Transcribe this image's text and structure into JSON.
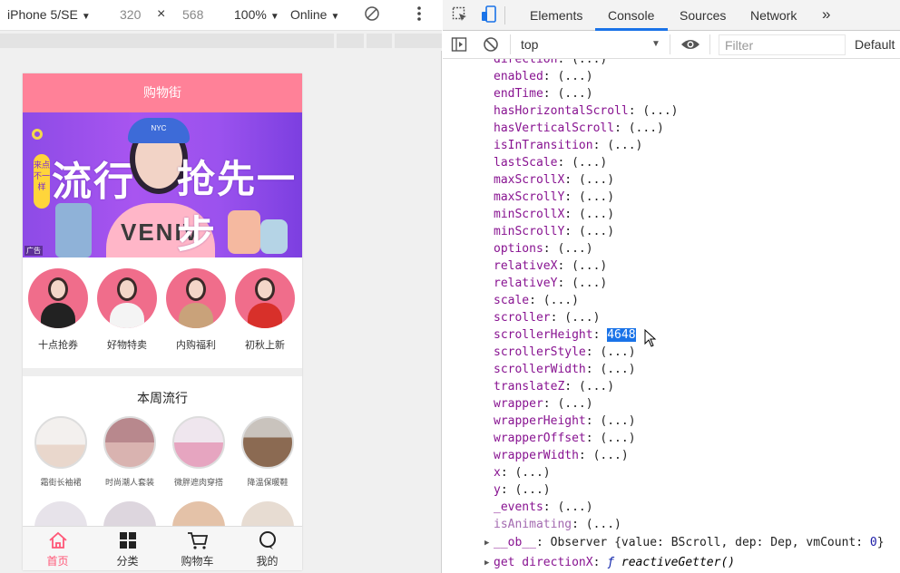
{
  "device_toolbar": {
    "device": "iPhone 5/SE",
    "width": "320",
    "times": "×",
    "height": "568",
    "zoom": "100%",
    "network": "Online"
  },
  "app": {
    "title": "购物街",
    "banner": {
      "headline_left": "流行",
      "headline_right": "抢先一步",
      "tag": "来点不一样",
      "cap_text": "NYC",
      "shirt_text": "VENIV",
      "ad_label": "广告"
    },
    "categories": [
      {
        "label": "十点抢券"
      },
      {
        "label": "好物特卖"
      },
      {
        "label": "内购福利"
      },
      {
        "label": "初秋上新"
      }
    ],
    "weekly": {
      "title": "本周流行",
      "items": [
        {
          "label": "霜街长袖裙"
        },
        {
          "label": "时尚潮人套装"
        },
        {
          "label": "微胖遮肉穿搭"
        },
        {
          "label": "降温保暖鞋"
        }
      ]
    },
    "tabs": [
      {
        "label": "首页",
        "icon": "home-icon"
      },
      {
        "label": "分类",
        "icon": "grid-icon"
      },
      {
        "label": "购物车",
        "icon": "cart-icon"
      },
      {
        "label": "我的",
        "icon": "user-icon"
      }
    ]
  },
  "devtools": {
    "tabs": [
      "Elements",
      "Console",
      "Sources",
      "Network"
    ],
    "active_tab": "Console",
    "more": "»",
    "context": "top",
    "filter_placeholder": "Filter",
    "levels": "Default",
    "properties": [
      {
        "key": "direction",
        "val": "(...)"
      },
      {
        "key": "enabled",
        "val": "(...)"
      },
      {
        "key": "endTime",
        "val": "(...)"
      },
      {
        "key": "hasHorizontalScroll",
        "val": "(...)"
      },
      {
        "key": "hasVerticalScroll",
        "val": "(...)"
      },
      {
        "key": "isInTransition",
        "val": "(...)"
      },
      {
        "key": "lastScale",
        "val": "(...)"
      },
      {
        "key": "maxScrollX",
        "val": "(...)"
      },
      {
        "key": "maxScrollY",
        "val": "(...)"
      },
      {
        "key": "minScrollX",
        "val": "(...)"
      },
      {
        "key": "minScrollY",
        "val": "(...)"
      },
      {
        "key": "options",
        "val": "(...)"
      },
      {
        "key": "relativeX",
        "val": "(...)"
      },
      {
        "key": "relativeY",
        "val": "(...)"
      },
      {
        "key": "scale",
        "val": "(...)"
      },
      {
        "key": "scroller",
        "val": "(...)"
      },
      {
        "key": "scrollerHeight",
        "val": "4648"
      },
      {
        "key": "scrollerStyle",
        "val": "(...)"
      },
      {
        "key": "scrollerWidth",
        "val": "(...)"
      },
      {
        "key": "translateZ",
        "val": "(...)"
      },
      {
        "key": "wrapper",
        "val": "(...)"
      },
      {
        "key": "wrapperHeight",
        "val": "(...)"
      },
      {
        "key": "wrapperOffset",
        "val": "(...)"
      },
      {
        "key": "wrapperWidth",
        "val": "(...)"
      },
      {
        "key": "x",
        "val": "(...)"
      },
      {
        "key": "y",
        "val": "(...)"
      },
      {
        "key": "_events",
        "val": "(...)"
      },
      {
        "key": "isAnimating",
        "val": "(...)"
      }
    ],
    "ob_line": {
      "key": "__ob__",
      "type": "Observer",
      "open": "{value: ",
      "value": "BScroll",
      "dep_label": ", dep: ",
      "dep": "Dep",
      "vm_label": ", vmCount: ",
      "vm_count": "0",
      "close": "}"
    },
    "getter_line": {
      "key": "get directionX",
      "sep": ": ",
      "f": "ƒ",
      "name": "reactiveGetter()"
    }
  },
  "colors": {
    "nav_pink": "#ff8198",
    "tab_active": "#ff5777",
    "devtools_blue": "#1a73e8",
    "key_purple": "#881391"
  }
}
